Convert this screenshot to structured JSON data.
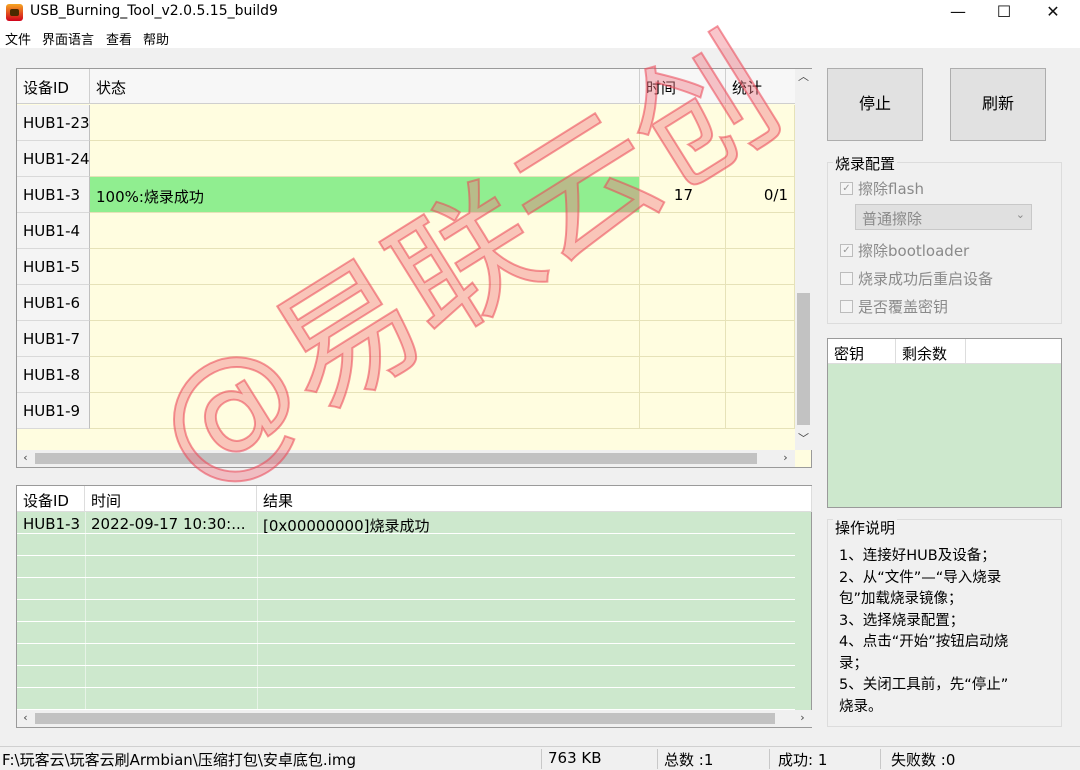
{
  "window": {
    "title": "USB_Burning_Tool_v2.0.5.15_build9",
    "controls": [
      "—",
      "☐",
      "✕"
    ]
  },
  "menu": [
    "文件",
    "界面语言",
    "查看",
    "帮助"
  ],
  "device_table": {
    "headers": [
      "设备ID",
      "状态",
      "时间",
      "统计"
    ],
    "rows": [
      {
        "id": "HUB1-23",
        "status": "",
        "time": "",
        "count": ""
      },
      {
        "id": "HUB1-24",
        "status": "",
        "time": "",
        "count": ""
      },
      {
        "id": "HUB1-3",
        "status": "100%:烧录成功",
        "time": "17",
        "count": "0/1"
      },
      {
        "id": "HUB1-4",
        "status": "",
        "time": "",
        "count": ""
      },
      {
        "id": "HUB1-5",
        "status": "",
        "time": "",
        "count": ""
      },
      {
        "id": "HUB1-6",
        "status": "",
        "time": "",
        "count": ""
      },
      {
        "id": "HUB1-7",
        "status": "",
        "time": "",
        "count": ""
      },
      {
        "id": "HUB1-8",
        "status": "",
        "time": "",
        "count": ""
      },
      {
        "id": "HUB1-9",
        "status": "",
        "time": "",
        "count": ""
      }
    ]
  },
  "log_table": {
    "headers": [
      "设备ID",
      "时间",
      "结果"
    ],
    "rows": [
      {
        "id": "HUB1-3",
        "time": "2022-09-17 10:30:...",
        "result": "[0x00000000]烧录成功"
      }
    ]
  },
  "buttons": {
    "stop": "停止",
    "refresh": "刷新"
  },
  "config": {
    "title": "烧录配置",
    "erase_flash": "擦除flash",
    "erase_mode": "普通擦除",
    "erase_bootloader": "擦除bootloader",
    "reboot_after": "烧录成功后重启设备",
    "overwrite_key": "是否覆盖密钥"
  },
  "key_table": {
    "headers": [
      "密钥",
      "剩余数"
    ]
  },
  "help": {
    "title": "操作说明",
    "lines": [
      "1、连接好HUB及设备；",
      "2、从“文件”—“导入烧录",
      "包”加载烧录镜像；",
      "3、选择烧录配置；",
      "4、点击“开始”按钮启动烧",
      "录；",
      "5、关闭工具前，先“停止”",
      "烧录。"
    ]
  },
  "status_bar": {
    "path": "F:\\玩客云\\玩客云刷Armbian\\压缩打包\\安卓底包.img",
    "size": "763 KB",
    "total": "总数 :1",
    "success": "成功: 1",
    "fail": "失败数 :0"
  },
  "watermark": "@易联云创",
  "colors": {
    "success_row": "#90ee90",
    "table_bg": "#fffde0",
    "log_bg": "#cde8cd"
  }
}
